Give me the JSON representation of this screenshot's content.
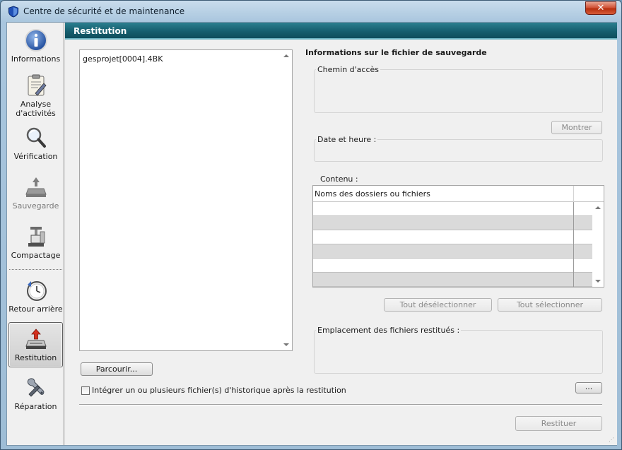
{
  "window": {
    "title": "Centre de sécurité et de maintenance",
    "close_label": "✕"
  },
  "nav": {
    "items": [
      {
        "label": "Informations",
        "icon": "info-icon",
        "state": "normal"
      },
      {
        "label": "Analyse d'activités",
        "icon": "clipboard-icon",
        "state": "normal"
      },
      {
        "label": "Vérification",
        "icon": "magnifier-icon",
        "state": "normal"
      },
      {
        "label": "Sauvegarde",
        "icon": "backup-icon",
        "state": "disabled"
      },
      {
        "label": "Compactage",
        "icon": "compress-icon",
        "state": "normal"
      },
      {
        "label": "Retour arrière",
        "icon": "rollback-clock-icon",
        "state": "normal"
      },
      {
        "label": "Restitution",
        "icon": "restore-icon",
        "state": "active"
      },
      {
        "label": "Réparation",
        "icon": "wrench-icon",
        "state": "normal"
      }
    ]
  },
  "panel": {
    "title": "Restitution"
  },
  "file_list": {
    "items": [
      "gesprojet[0004].4BK"
    ]
  },
  "buttons": {
    "browse": "Parcourir...",
    "show": "Montrer",
    "deselect_all": "Tout désélectionner",
    "select_all": "Tout sélectionner",
    "ellipsis": "...",
    "restore": "Restituer"
  },
  "info": {
    "section_title": "Informations sur le fichier de sauvegarde",
    "path_label": "Chemin d'accès",
    "datetime_label": "Date et heure :",
    "content_label": "Contenu :",
    "table_header": "Noms des dossiers ou fichiers",
    "location_label": "Emplacement des fichiers restitués :"
  },
  "checkbox": {
    "label": "Intégrer un ou plusieurs fichier(s) d'historique après la restitution",
    "checked": false
  },
  "colors": {
    "header_teal": "#165f6f",
    "accent_border": "#6db4c2",
    "close_red": "#c8401f"
  }
}
